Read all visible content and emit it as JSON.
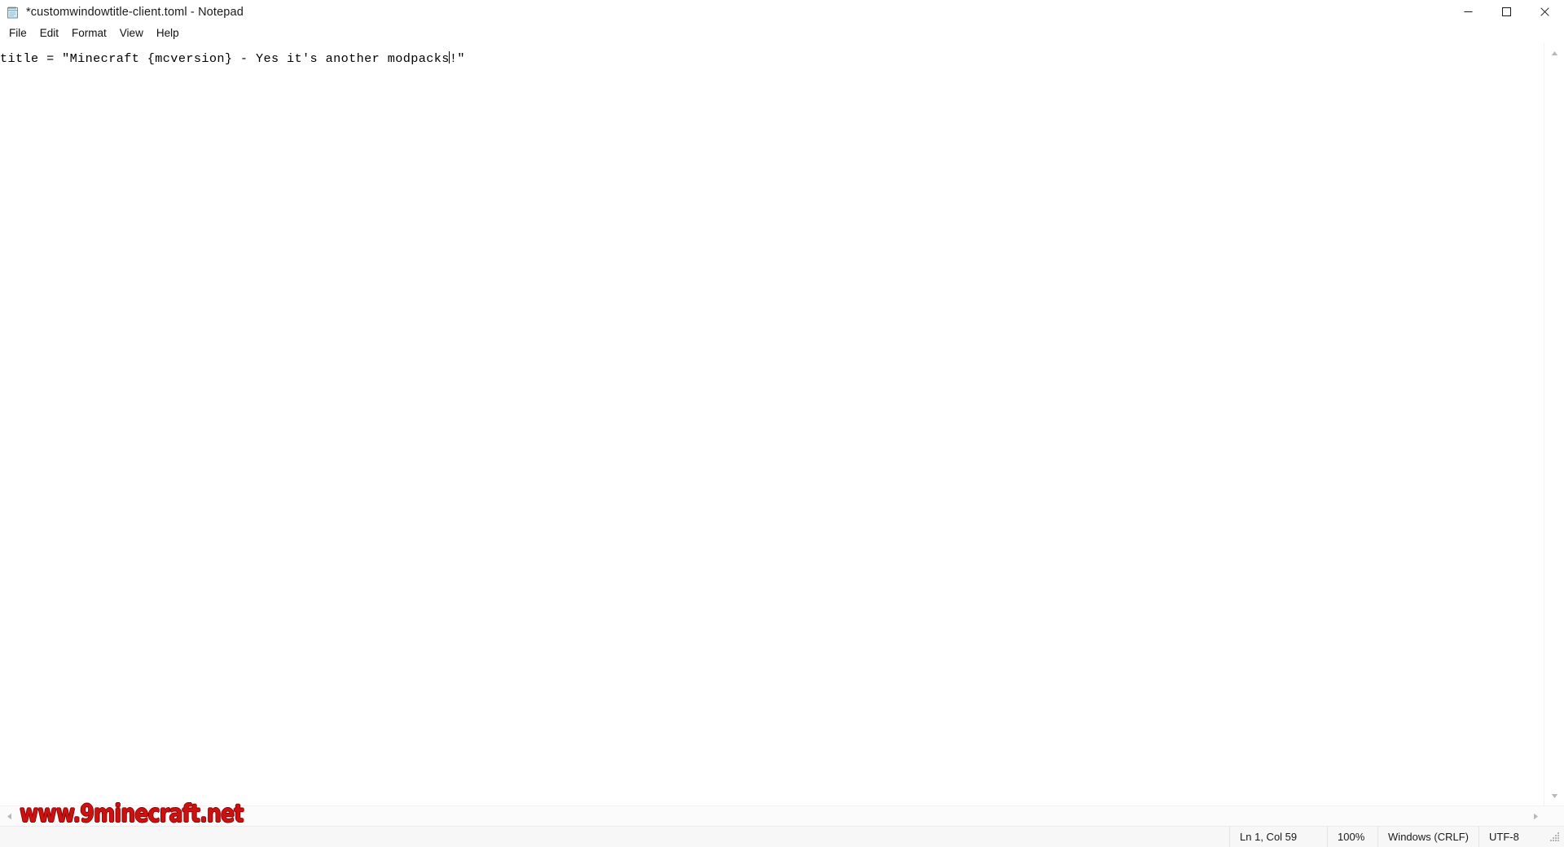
{
  "window": {
    "title": "*customwindowtitle-client.toml - Notepad",
    "icon": "notepad-icon",
    "controls": {
      "minimize_label": "—",
      "maximize_label": "☐",
      "close_label": "✕"
    }
  },
  "menu": {
    "items": [
      {
        "label": "File"
      },
      {
        "label": "Edit"
      },
      {
        "label": "Format"
      },
      {
        "label": "View"
      },
      {
        "label": "Help"
      }
    ]
  },
  "editor": {
    "content_before_caret": "title = \"Minecraft {mcversion} - Yes it's another modpacks",
    "content_after_caret": "!\"",
    "full_text": "title = \"Minecraft {mcversion} - Yes it's another modpacks!\""
  },
  "scrollbars": {
    "vertical_up_arrow": "▲",
    "vertical_down_arrow": "▼",
    "horizontal_left_arrow": "◀",
    "horizontal_right_arrow": "▶"
  },
  "status_bar": {
    "position": "Ln 1, Col 59",
    "zoom": "100%",
    "line_ending": "Windows (CRLF)",
    "encoding": "UTF-8"
  },
  "watermark": {
    "text": "www.9minecraft.net",
    "color": "#cc1111"
  },
  "colors": {
    "window_bg": "#ffffff",
    "status_bg": "#f7f7f7",
    "text": "#000000",
    "watermark_red": "#cc1111",
    "watermark_outline": "#8b0000"
  }
}
